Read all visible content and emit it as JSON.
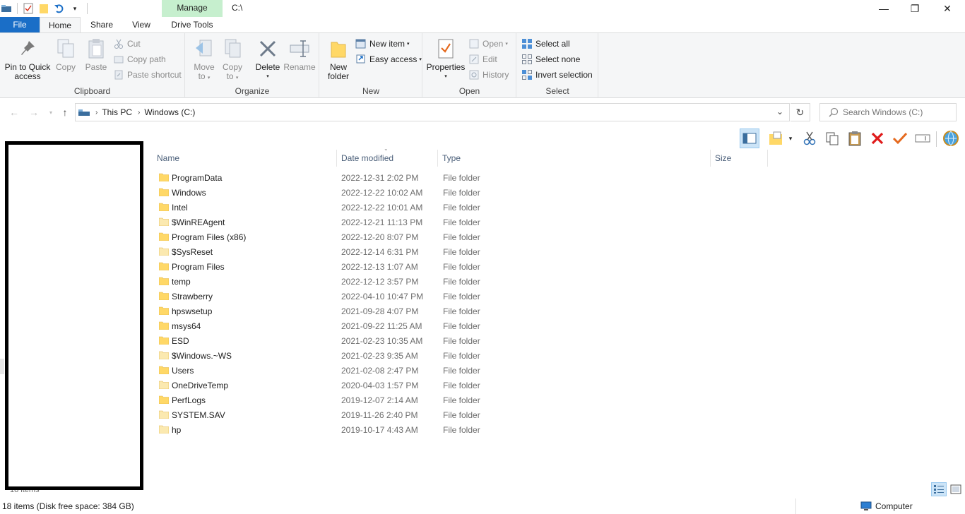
{
  "window": {
    "title": "C:\\",
    "context_tab": "Manage",
    "minimize": "—",
    "maximize": "❐",
    "close": "✕"
  },
  "tabs": [
    "File",
    "Home",
    "Share",
    "View",
    "Drive Tools"
  ],
  "ribbon": {
    "clipboard": {
      "label": "Clipboard",
      "pin": [
        "Pin to Quick",
        "access"
      ],
      "copy": "Copy",
      "paste": "Paste",
      "cut": "Cut",
      "copy_path": "Copy path",
      "paste_shortcut": "Paste shortcut"
    },
    "organize": {
      "label": "Organize",
      "move_to": [
        "Move",
        "to"
      ],
      "copy_to": [
        "Copy",
        "to"
      ],
      "delete": "Delete",
      "rename": "Rename"
    },
    "new": {
      "label": "New",
      "new_folder": [
        "New",
        "folder"
      ],
      "new_item": "New item",
      "easy_access": "Easy access"
    },
    "open": {
      "label": "Open",
      "properties": "Properties",
      "open": "Open",
      "edit": "Edit",
      "history": "History"
    },
    "select": {
      "label": "Select",
      "select_all": "Select all",
      "select_none": "Select none",
      "invert": "Invert selection"
    }
  },
  "address": {
    "this_pc": "This PC",
    "drive": "Windows (C:)",
    "search_placeholder": "Search Windows (C:)"
  },
  "columns": {
    "name": "Name",
    "date": "Date modified",
    "type": "Type",
    "size": "Size"
  },
  "files": [
    {
      "name": "ProgramData",
      "date": "2022-12-31 2:02 PM",
      "type": "File folder",
      "faded": false
    },
    {
      "name": "Windows",
      "date": "2022-12-22 10:02 AM",
      "type": "File folder",
      "faded": false
    },
    {
      "name": "Intel",
      "date": "2022-12-22 10:01 AM",
      "type": "File folder",
      "faded": false
    },
    {
      "name": "$WinREAgent",
      "date": "2022-12-21 11:13 PM",
      "type": "File folder",
      "faded": true
    },
    {
      "name": "Program Files (x86)",
      "date": "2022-12-20 8:07 PM",
      "type": "File folder",
      "faded": false
    },
    {
      "name": "$SysReset",
      "date": "2022-12-14 6:31 PM",
      "type": "File folder",
      "faded": true
    },
    {
      "name": "Program Files",
      "date": "2022-12-13 1:07 AM",
      "type": "File folder",
      "faded": false
    },
    {
      "name": "temp",
      "date": "2022-12-12 3:57 PM",
      "type": "File folder",
      "faded": false
    },
    {
      "name": "Strawberry",
      "date": "2022-04-10 10:47 PM",
      "type": "File folder",
      "faded": false
    },
    {
      "name": "hpswsetup",
      "date": "2021-09-28 4:07 PM",
      "type": "File folder",
      "faded": false
    },
    {
      "name": "msys64",
      "date": "2021-09-22 11:25 AM",
      "type": "File folder",
      "faded": false
    },
    {
      "name": "ESD",
      "date": "2021-02-23 10:35 AM",
      "type": "File folder",
      "faded": false
    },
    {
      "name": "$Windows.~WS",
      "date": "2021-02-23 9:35 AM",
      "type": "File folder",
      "faded": true
    },
    {
      "name": "Users",
      "date": "2021-02-08 2:47 PM",
      "type": "File folder",
      "faded": false
    },
    {
      "name": "OneDriveTemp",
      "date": "2020-04-03 1:57 PM",
      "type": "File folder",
      "faded": true
    },
    {
      "name": "PerfLogs",
      "date": "2019-12-07 2:14 AM",
      "type": "File folder",
      "faded": false
    },
    {
      "name": "SYSTEM.SAV",
      "date": "2019-11-26 2:40 PM",
      "type": "File folder",
      "faded": true
    },
    {
      "name": "hp",
      "date": "2019-10-17 4:43 AM",
      "type": "File folder",
      "faded": true
    }
  ],
  "nav_pane_peek": "18 items",
  "status": {
    "summary": "18 items (Disk free space: 384 GB)",
    "location": "Computer"
  },
  "colors": {
    "file_tab": "#1a6ec7",
    "manage_tab": "#c6efce",
    "folder": "#ffd867",
    "folder_faded": "#fbe9b0",
    "header_text": "#4c607a"
  }
}
